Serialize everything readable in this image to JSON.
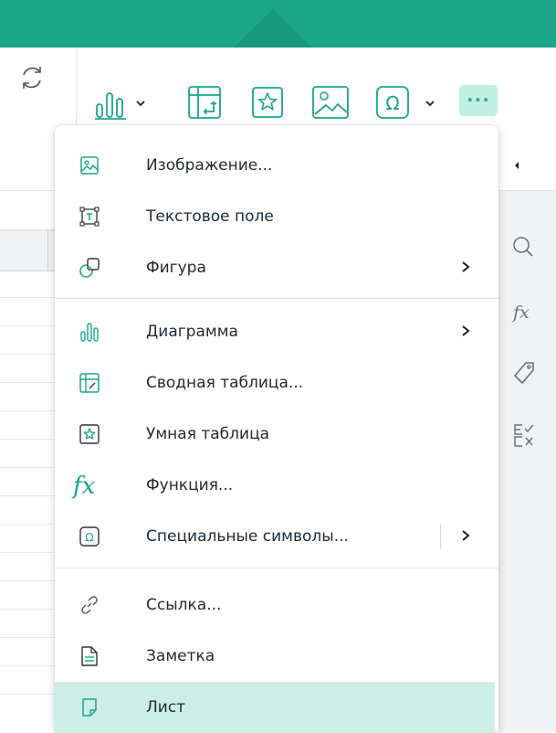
{
  "colors": {
    "accent": "#1aa68a",
    "active_bg": "#cdeee6",
    "more_bg": "#bfeee2"
  },
  "toolbar": {
    "refresh_icon": "refresh-icon",
    "chart_icon": "bar-chart-icon",
    "pivot_icon": "pivot-table-icon",
    "smart_table_icon": "star-table-icon",
    "image_icon": "image-icon",
    "symbol_icon": "omega-icon",
    "more_label": "•••"
  },
  "menu": {
    "items": [
      {
        "label": "Изображение...",
        "icon": "image-icon"
      },
      {
        "label": "Текстовое поле",
        "icon": "text-field-icon"
      },
      {
        "label": "Фигура",
        "icon": "shape-icon",
        "submenu": true
      },
      {
        "label": "Диаграмма",
        "icon": "bar-chart-icon",
        "submenu": true
      },
      {
        "label": "Сводная таблица...",
        "icon": "pivot-table-icon"
      },
      {
        "label": "Умная таблица",
        "icon": "star-table-icon"
      },
      {
        "label": "Функция...",
        "icon": "function-icon"
      },
      {
        "label": "Специальные символы...",
        "icon": "omega-icon",
        "submenu": true
      },
      {
        "label": "Ссылка...",
        "icon": "link-icon"
      },
      {
        "label": "Заметка",
        "icon": "note-icon"
      },
      {
        "label": "Лист",
        "icon": "sheet-icon",
        "active": true
      }
    ]
  },
  "right_panel": {
    "icons": [
      "chevron-up-icon",
      "search-icon",
      "fx-icon",
      "tag-icon",
      "checklist-icon"
    ]
  }
}
